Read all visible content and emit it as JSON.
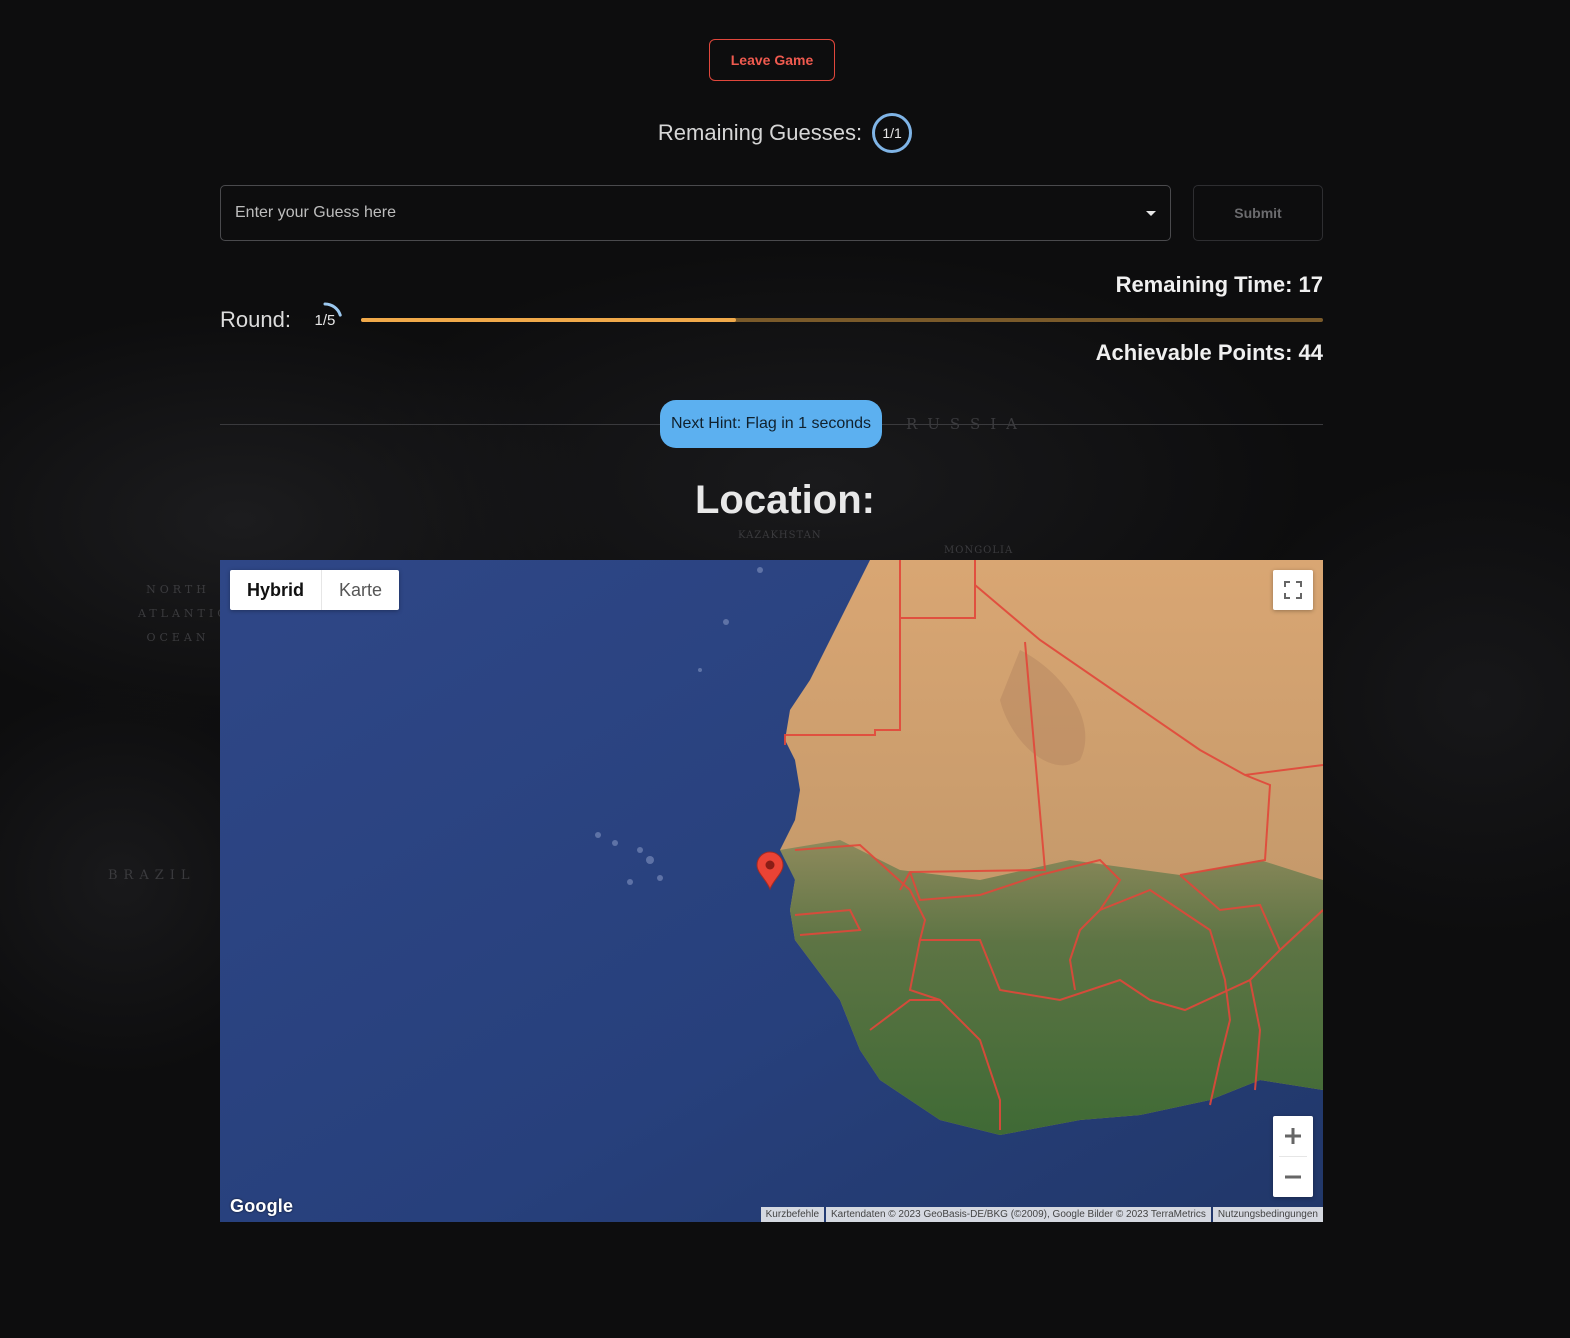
{
  "header": {
    "leave_label": "Leave Game"
  },
  "guesses": {
    "label": "Remaining Guesses:",
    "value": "1/1"
  },
  "guess_input": {
    "placeholder": "Enter your Guess here",
    "submit_label": "Submit"
  },
  "timer": {
    "label": "Remaining Time: 17",
    "progress_fraction": 0.39,
    "fill_color": "#f0a94a",
    "track_color": "#7a5a2a"
  },
  "round": {
    "label": "Round:",
    "value": "1/5",
    "progress_fraction": 0.2
  },
  "points": {
    "label": "Achievable Points: 44"
  },
  "hint": {
    "label": "Next Hint: Flag in 1 seconds",
    "color": "#5cb0f0"
  },
  "location": {
    "heading": "Location:"
  },
  "map": {
    "type_options": [
      "Hybrid",
      "Karte"
    ],
    "selected_type": "Hybrid",
    "zoom_in": "+",
    "zoom_out": "−",
    "logo": "Google",
    "attribution": {
      "shortcuts": "Kurzbefehle",
      "data": "Kartendaten © 2023 GeoBasis-DE/BKG (©2009), Google Bilder © 2023 TerraMetrics",
      "terms": "Nutzungsbedingungen"
    },
    "marker_color": "#ea4335"
  },
  "background_labels": [
    "RUSSIA",
    "BRAZIL",
    "KAZAKHSTAN",
    "MONGOLIA",
    "NORTH ATLANTIC OCEAN"
  ]
}
